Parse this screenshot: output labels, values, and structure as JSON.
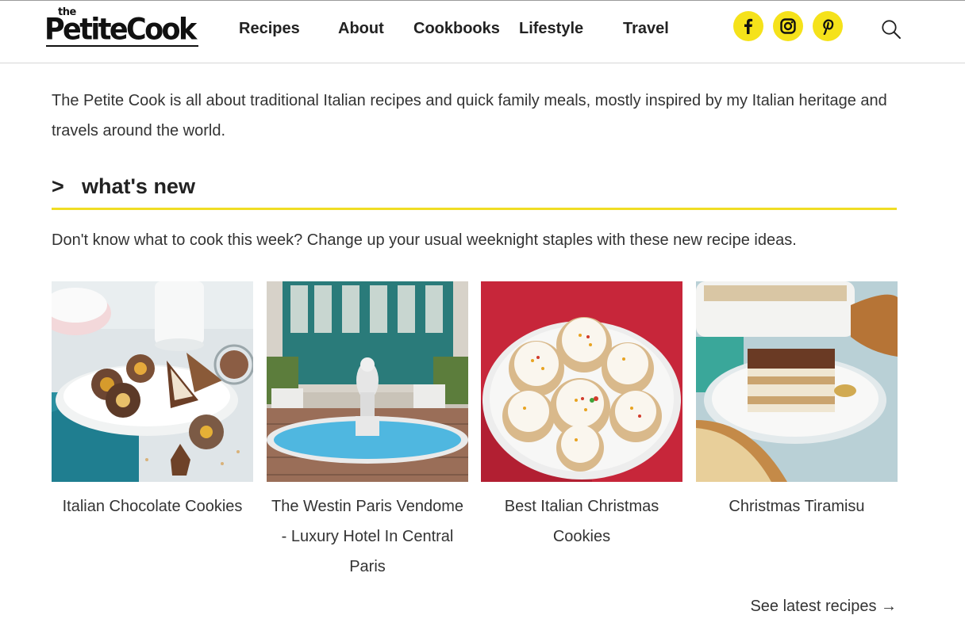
{
  "site": {
    "logo_the": "the",
    "logo_name": "PetiteCook"
  },
  "nav": {
    "items": [
      {
        "label": "Recipes"
      },
      {
        "label": "About"
      },
      {
        "label": "Cookbooks"
      },
      {
        "label": "Lifestyle"
      },
      {
        "label": "Travel"
      }
    ],
    "social": [
      "facebook-icon",
      "instagram-icon",
      "pinterest-icon"
    ],
    "search_icon": "search-icon"
  },
  "colors": {
    "accent_yellow": "#f5e21a",
    "rule_yellow": "#f0dd24",
    "text": "#333333"
  },
  "intro": {
    "text": "The Petite Cook is all about traditional Italian recipes and quick family meals, mostly inspired by my Italian heritage and travels around the world."
  },
  "whats_new": {
    "chevron": ">",
    "heading": "what's new",
    "description": "Don't know what to cook this week? Change up your usual weeknight staples with these new recipe ideas.",
    "cards": [
      {
        "title": "Italian Chocolate Cookies"
      },
      {
        "title": "The Westin Paris Vendome - Luxury Hotel In Central Paris"
      },
      {
        "title": "Best Italian Christmas Cookies"
      },
      {
        "title": "Christmas Tiramisu"
      }
    ],
    "see_latest": "See latest recipes →"
  }
}
